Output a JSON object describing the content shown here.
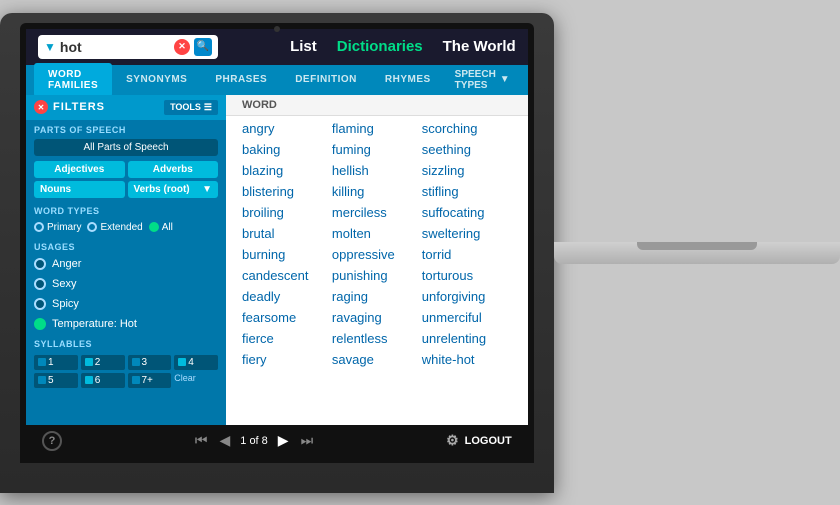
{
  "search": {
    "value": "hot",
    "placeholder": "hot"
  },
  "top_nav": {
    "items": [
      {
        "label": "List",
        "active": false
      },
      {
        "label": "Dictionaries",
        "active": true
      },
      {
        "label": "The World",
        "active": false
      }
    ]
  },
  "tabs": [
    {
      "label": "Word Families",
      "active": true
    },
    {
      "label": "Synonyms",
      "active": false
    },
    {
      "label": "Phrases",
      "active": false
    },
    {
      "label": "Definition",
      "active": false
    },
    {
      "label": "Rhymes",
      "active": false
    },
    {
      "label": "Speech Types",
      "active": false,
      "has_arrow": true
    }
  ],
  "filters": {
    "label": "FILTERS",
    "tools_label": "TOOLS"
  },
  "sidebar": {
    "parts_of_speech_label": "PARTS OF SPEECH",
    "all_parts_btn": "All Parts of Speech",
    "pos_buttons": [
      "Adjectives",
      "Adverbs",
      "Nouns",
      "Verbs (root)"
    ],
    "word_types_label": "WORD TYPES",
    "word_types": [
      "Primary",
      "Extended",
      "All"
    ],
    "usages_label": "USAGES",
    "usages": [
      {
        "label": "Anger",
        "active": false
      },
      {
        "label": "Sexy",
        "active": false
      },
      {
        "label": "Spicy",
        "active": false
      },
      {
        "label": "Temperature: Hot",
        "active": true
      }
    ],
    "syllables_label": "SYLLABLES",
    "syllables": [
      "1",
      "2",
      "3",
      "4",
      "5",
      "6",
      "7+"
    ],
    "clear_label": "Clear"
  },
  "word_list": {
    "header": [
      "Word",
      "",
      ""
    ],
    "words": [
      [
        "angry",
        "flaming",
        "scorching"
      ],
      [
        "baking",
        "fuming",
        "seething"
      ],
      [
        "blazing",
        "hellish",
        "sizzling"
      ],
      [
        "blistering",
        "killing",
        "stifling"
      ],
      [
        "broiling",
        "merciless",
        "suffocating"
      ],
      [
        "brutal",
        "molten",
        "sweltering"
      ],
      [
        "burning",
        "oppressive",
        "torrid"
      ],
      [
        "candescent",
        "punishing",
        "torturous"
      ],
      [
        "deadly",
        "raging",
        "unforgiving"
      ],
      [
        "fearsome",
        "ravaging",
        "unmerciful"
      ],
      [
        "fierce",
        "relentless",
        "unrelenting"
      ],
      [
        "fiery",
        "savage",
        "white-hot"
      ]
    ]
  },
  "pagination": {
    "page": "1",
    "total": "8",
    "display": "1 of 8"
  },
  "bottom": {
    "help_label": "?",
    "logout_label": "LOGOUT"
  }
}
